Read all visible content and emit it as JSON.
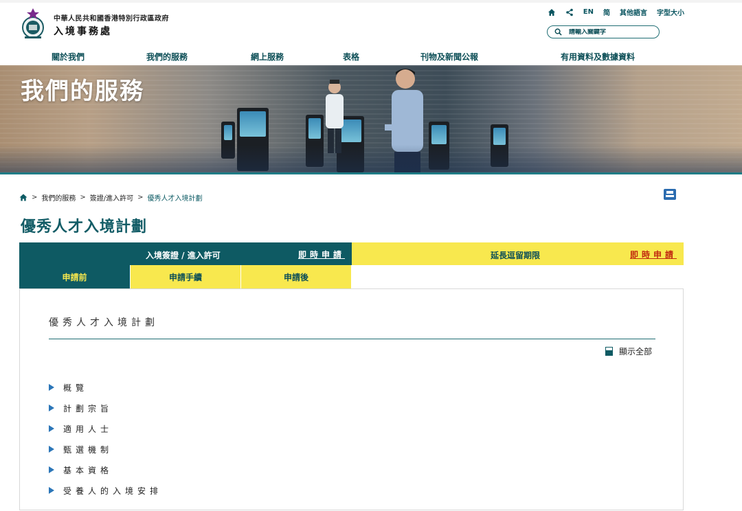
{
  "header": {
    "gov_name": "中華人民共和國香港特別行政區政府",
    "dept_name": "入境事務處",
    "top_links": {
      "lang_en": "EN",
      "lang_sc": "简",
      "other_lang": "其他語言",
      "font_size": "字型大小"
    },
    "search_placeholder": "請輸入關鍵字"
  },
  "nav": {
    "items": [
      "關於我們",
      "我們的服務",
      "網上服務",
      "表格",
      "刊物及新聞公報",
      "有用資料及數據資料"
    ]
  },
  "banner": {
    "title": "我們的服務"
  },
  "breadcrumb": {
    "items": [
      "我們的服務",
      "簽證/進入許可",
      "優秀人才入境計劃"
    ],
    "separator": ">"
  },
  "page": {
    "title": "優秀人才入境計劃"
  },
  "tabs": {
    "entry_label": "入境簽證 / 進入許可",
    "entry_apply": "即時申請",
    "extend_label": "延長逗留期限",
    "extend_apply": "即時申請",
    "subtabs": [
      "申請前",
      "申請手續",
      "申請後"
    ]
  },
  "content": {
    "section_title": "優秀人才入境計劃",
    "show_all": "顯示全部",
    "items": [
      "概覽",
      "計劃宗旨",
      "適用人士",
      "甄選機制",
      "基本資格",
      "受養人的入境安排"
    ]
  },
  "colors": {
    "brand_teal": "#0e5a63",
    "accent_yellow": "#f8e84e",
    "link_red": "#c1290f",
    "arrow_blue": "#2b76b8"
  }
}
